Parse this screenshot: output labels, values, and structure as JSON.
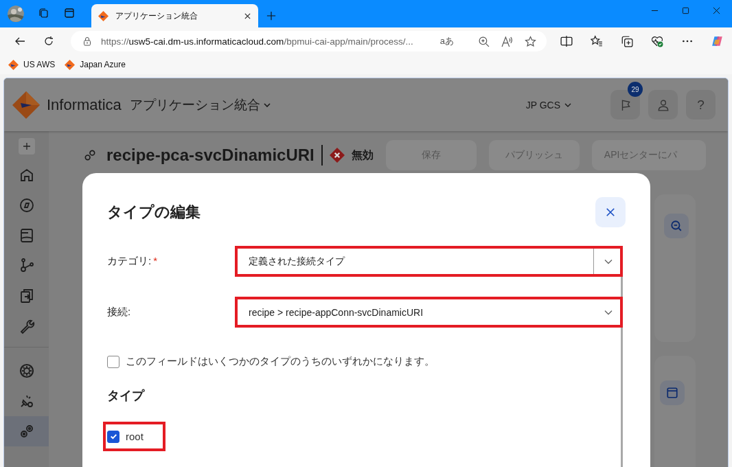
{
  "browser": {
    "tab": {
      "title": "アプリケーション統合",
      "selected": true
    },
    "address": {
      "scheme": "https://",
      "host": "usw5-cai.dm-us.informaticacloud.com",
      "path": "/bpmui-cai-app/main/process/..."
    },
    "translate_glyph": "aあ",
    "bookmarks": [
      {
        "label": "US AWS"
      },
      {
        "label": "Japan Azure"
      }
    ]
  },
  "app": {
    "brand": "Informatica",
    "product": "アプリケーション統合",
    "org": "JP GCS",
    "notification_count": "29",
    "help_label": "?",
    "sidebar": {
      "items": [
        {
          "selected": false
        },
        {
          "selected": false
        },
        {
          "selected": false
        },
        {
          "selected": false
        },
        {
          "selected": false
        },
        {
          "selected": false
        },
        {
          "selected": false
        },
        {
          "selected": false
        },
        {
          "selected": true
        }
      ]
    },
    "process": {
      "title": "recipe-pca-svcDinamicURI",
      "status": "無効",
      "buttons": [
        "保存",
        "パブリッシュ",
        "APIセンターにパ"
      ]
    }
  },
  "dialog": {
    "title": "タイプの編集",
    "fields": [
      {
        "label": "カテゴリ:",
        "required_mark": "*",
        "value": "定義された接続タイプ",
        "kind": "select-split",
        "highlighted": true
      },
      {
        "label": "接続:",
        "value": "recipe > recipe-appConn-svcDinamicURI",
        "kind": "select",
        "highlighted": true
      }
    ],
    "multi_type": {
      "label": "このフィールドはいくつかのタイプのうちのいずれかになります。",
      "checked": false
    },
    "types_heading": "タイプ",
    "types": [
      {
        "label": "root",
        "checked": true,
        "highlighted": true
      }
    ]
  }
}
